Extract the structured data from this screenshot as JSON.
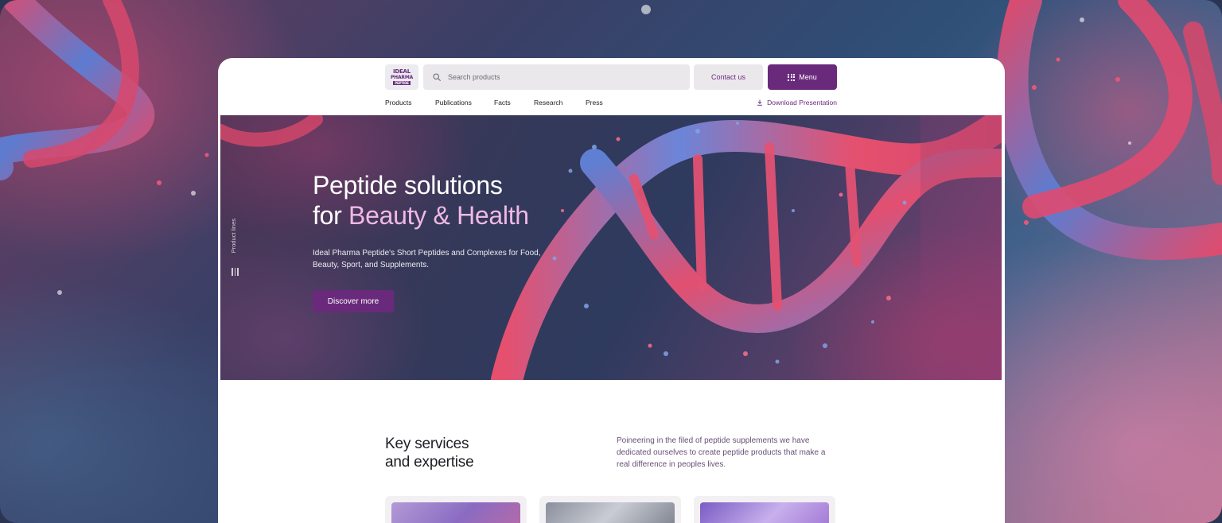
{
  "header": {
    "logo": {
      "line1": "IDEAL",
      "line2": "PHARMA",
      "line3": "PEPTIDE"
    },
    "search_placeholder": "Search products",
    "contact_label": "Contact us",
    "menu_label": "Menu"
  },
  "nav": {
    "items": [
      "Products",
      "Publications",
      "Facts",
      "Research",
      "Press"
    ],
    "download_label": "Download Presentation"
  },
  "hero": {
    "title_line1": "Peptide solutions",
    "title_line2_prefix": "for ",
    "title_line2_highlight": "Beauty & Health",
    "subtitle": "Ideal Pharma Peptide's Short Peptides and Complexes for Food, Beauty, Sport, and Supplements.",
    "cta_label": "Discover more",
    "side_tab_label": "Product lines"
  },
  "services": {
    "title_line1": "Key services",
    "title_line2": "and expertise",
    "description": "Poineering in the filed of peptide supplements we have dedicated ourselves to create peptide products that make a real difference in peoples lives."
  },
  "colors": {
    "brand": "#6a2a7c",
    "highlight": "#f0b9e4"
  }
}
